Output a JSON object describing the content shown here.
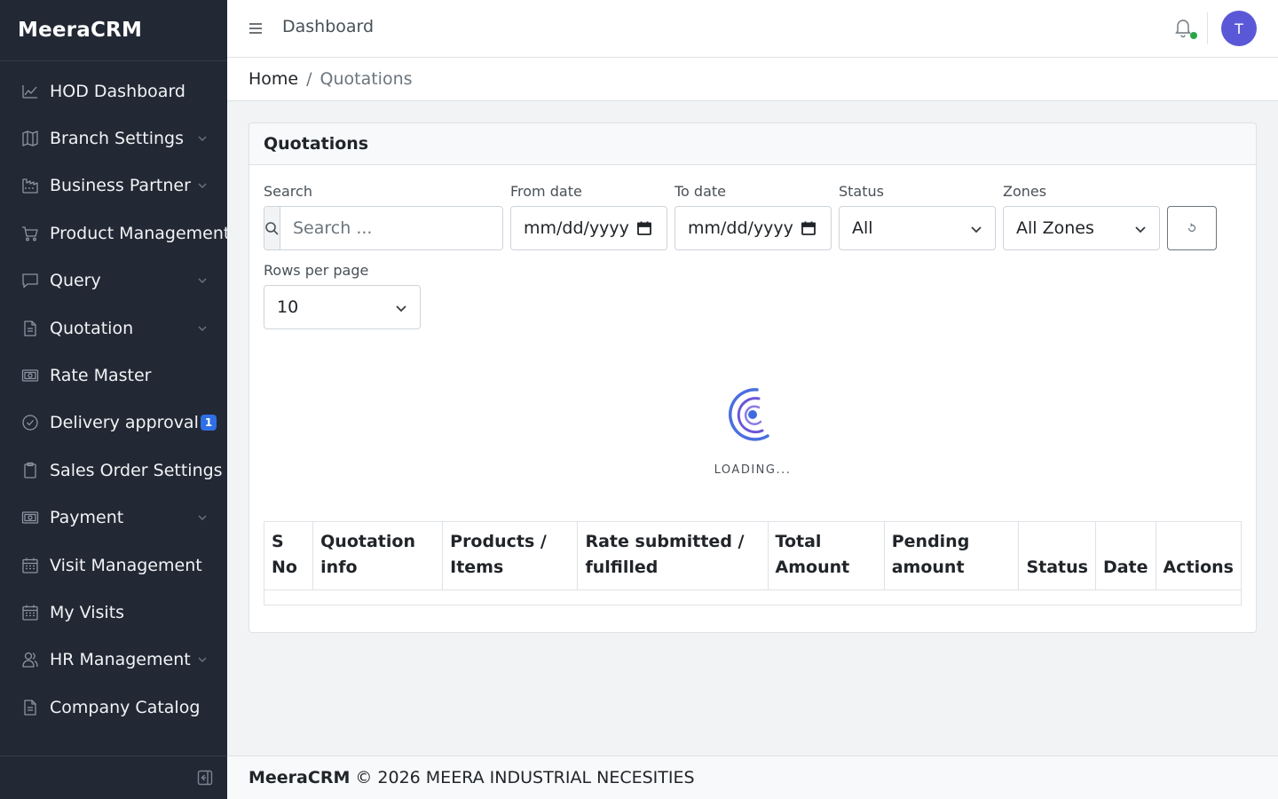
{
  "brand": "MeeraCRM",
  "sidebar": {
    "items": [
      {
        "label": "HOD Dashboard",
        "icon": "chart-line-icon",
        "has_children": false
      },
      {
        "label": "Branch Settings",
        "icon": "map-icon",
        "has_children": true
      },
      {
        "label": "Business Partner",
        "icon": "building-icon",
        "has_children": true
      },
      {
        "label": "Product Management",
        "icon": "cart-icon",
        "has_children": false
      },
      {
        "label": "Query",
        "icon": "message-square-icon",
        "has_children": true
      },
      {
        "label": "Quotation",
        "icon": "document-icon",
        "has_children": true
      },
      {
        "label": "Rate Master",
        "icon": "banknote-icon",
        "has_children": false
      },
      {
        "label": "Delivery approval",
        "icon": "check-circle-icon",
        "has_children": false,
        "badge": "1"
      },
      {
        "label": "Sales Order Settings",
        "icon": "clipboard-icon",
        "has_children": false
      },
      {
        "label": "Payment",
        "icon": "banknote-icon",
        "has_children": true
      },
      {
        "label": "Visit Management",
        "icon": "calendar-icon",
        "has_children": false
      },
      {
        "label": "My Visits",
        "icon": "calendar-icon",
        "has_children": false
      },
      {
        "label": "HR Management",
        "icon": "users-icon",
        "has_children": true
      },
      {
        "label": "Company Catalog",
        "icon": "document-icon",
        "has_children": false
      }
    ]
  },
  "header": {
    "title": "Dashboard",
    "avatar_initial": "T"
  },
  "breadcrumb": {
    "home": "Home",
    "separator": "/",
    "current": "Quotations"
  },
  "card": {
    "title": "Quotations"
  },
  "filters": {
    "search_label": "Search",
    "search_placeholder": "Search ...",
    "from_label": "From date",
    "from_value": "mm/dd/yyyy",
    "to_label": "To date",
    "to_value": "mm/dd/yyyy",
    "status_label": "Status",
    "status_value": "All",
    "zones_label": "Zones",
    "zones_value": "All Zones",
    "rows_label": "Rows per page",
    "rows_value": "10"
  },
  "loading_text": "LOADING...",
  "table": {
    "headers": [
      "S No",
      "Quotation info",
      "Products / Items",
      "Rate submitted / fulfilled",
      "Total Amount",
      "Pending amount",
      "Status",
      "Date",
      "Actions"
    ]
  },
  "footer": {
    "brand": "MeeraCRM",
    "text": "© 2026 MEERA INDUSTRIAL NECESITIES"
  },
  "colors": {
    "sidebar_bg": "#222834",
    "accent": "#5b58d8",
    "badge": "#2f6fe6",
    "online": "#28a745"
  }
}
